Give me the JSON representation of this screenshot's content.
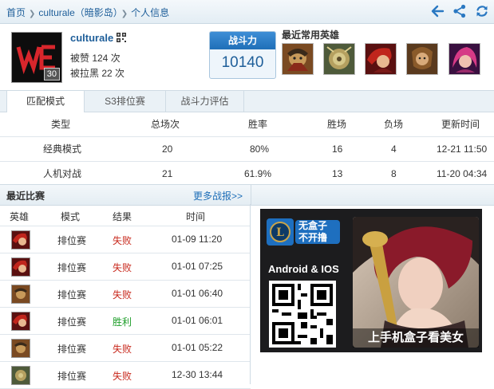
{
  "breadcrumb": {
    "home": "首页",
    "player": "culturale（暗影岛）",
    "page": "个人信息"
  },
  "toolbar": {
    "icons": [
      "back-arrow-icon",
      "share-icon",
      "refresh-icon"
    ]
  },
  "profile": {
    "name": "culturale",
    "level": "30",
    "likes": "被赞 124 次",
    "blacklisted": "被拉黑 22 次",
    "power_label": "战斗力",
    "power_value": "10140",
    "heroes_title": "最近常用英雄"
  },
  "tabs": [
    {
      "label": "匹配模式",
      "active": true
    },
    {
      "label": "S3排位赛",
      "active": false
    },
    {
      "label": "战斗力评估",
      "active": false
    }
  ],
  "mode_table": {
    "headers": [
      "类型",
      "总场次",
      "胜率",
      "胜场",
      "负场",
      "更新时间"
    ],
    "rows": [
      [
        "经典模式",
        "20",
        "80%",
        "16",
        "4",
        "12-21 11:50"
      ],
      [
        "人机对战",
        "21",
        "61.9%",
        "13",
        "8",
        "11-20 04:34"
      ]
    ]
  },
  "recent": {
    "title": "最近比赛",
    "more": "更多战报>>",
    "headers": [
      "英雄",
      "模式",
      "结果",
      "时间"
    ],
    "rows": [
      {
        "mode": "排位赛",
        "result": "失败",
        "time": "01-09 11:20"
      },
      {
        "mode": "排位赛",
        "result": "失败",
        "time": "01-01 07:25"
      },
      {
        "mode": "排位赛",
        "result": "失败",
        "time": "01-01 06:40"
      },
      {
        "mode": "排位赛",
        "result": "胜利",
        "time": "01-01 06:01"
      },
      {
        "mode": "排位赛",
        "result": "失败",
        "time": "01-01 05:22"
      },
      {
        "mode": "排位赛",
        "result": "失败",
        "time": "12-30 13:44"
      }
    ]
  },
  "ad": {
    "logo_text_1": "无盒子",
    "logo_text_2": "不开撸",
    "platform": "Android & IOS",
    "caption": "上手机盒子看美女"
  },
  "colors": {
    "link": "#1f5f9a",
    "accent": "#1f6fb8",
    "lose": "#c8281c",
    "win": "#1e9e2a"
  }
}
